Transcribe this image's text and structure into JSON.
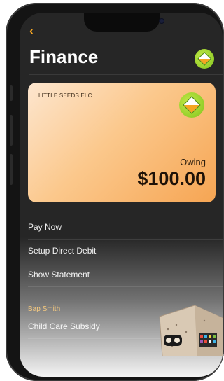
{
  "header": {
    "back_icon": "chevron-left",
    "title": "Finance"
  },
  "card": {
    "organization": "LITTLE SEEDS ELC",
    "status_label": "Owing",
    "amount": "$100.00"
  },
  "menu": [
    {
      "label": "Pay Now"
    },
    {
      "label": "Setup Direct Debit"
    },
    {
      "label": "Show Statement"
    }
  ],
  "child_section": {
    "child_name": "Bap Smith",
    "items": [
      {
        "label": "Child Care Subsidy"
      }
    ]
  },
  "colors": {
    "accent": "#f5a623",
    "background": "#262626",
    "card_start": "#fde6cf",
    "card_end": "#f6a553"
  }
}
